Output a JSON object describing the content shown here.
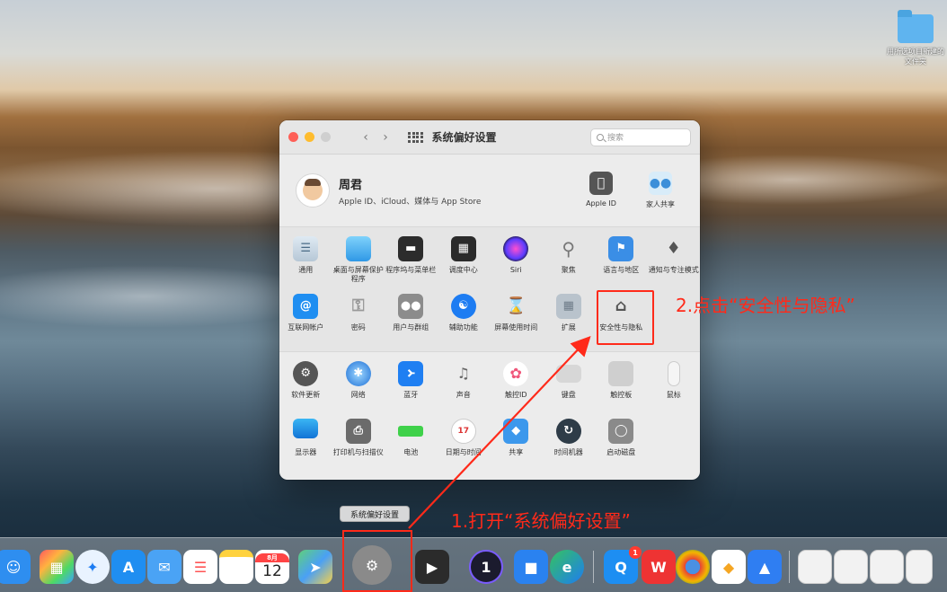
{
  "desktop": {
    "folder_label": "用所选项目新建的文件夹"
  },
  "window": {
    "title": "系统偏好设置",
    "search_placeholder": "搜索",
    "nav_back": "‹",
    "nav_forward": "›"
  },
  "account": {
    "name": "周君",
    "subtitle": "Apple ID、iCloud、媒体与 App Store",
    "apple_id_label": "Apple ID",
    "family_label": "家人共享"
  },
  "sections": {
    "row1": [
      {
        "label": "通用",
        "icon": "general-icon"
      },
      {
        "label": "桌面与屏幕保护程序",
        "icon": "desktop-icon"
      },
      {
        "label": "程序坞与菜单栏",
        "icon": "dock-icon"
      },
      {
        "label": "调度中心",
        "icon": "mission-control-icon"
      },
      {
        "label": "Siri",
        "icon": "siri-icon"
      },
      {
        "label": "聚焦",
        "icon": "spotlight-icon"
      },
      {
        "label": "语言与地区",
        "icon": "language-icon"
      },
      {
        "label": "通知与专注模式",
        "icon": "notifications-icon"
      }
    ],
    "row2": [
      {
        "label": "互联网帐户",
        "icon": "internet-accounts-icon"
      },
      {
        "label": "密码",
        "icon": "passwords-icon"
      },
      {
        "label": "用户与群组",
        "icon": "users-icon"
      },
      {
        "label": "辅助功能",
        "icon": "accessibility-icon"
      },
      {
        "label": "屏幕使用时间",
        "icon": "screen-time-icon"
      },
      {
        "label": "扩展",
        "icon": "extensions-icon"
      },
      {
        "label": "安全性与隐私",
        "icon": "security-icon"
      }
    ],
    "row3": [
      {
        "label": "软件更新",
        "icon": "software-update-icon"
      },
      {
        "label": "网络",
        "icon": "network-icon"
      },
      {
        "label": "蓝牙",
        "icon": "bluetooth-icon"
      },
      {
        "label": "声音",
        "icon": "sound-icon"
      },
      {
        "label": "触控ID",
        "icon": "touch-id-icon"
      },
      {
        "label": "键盘",
        "icon": "keyboard-icon"
      },
      {
        "label": "触控板",
        "icon": "trackpad-icon"
      },
      {
        "label": "鼠标",
        "icon": "mouse-icon"
      }
    ],
    "row4": [
      {
        "label": "显示器",
        "icon": "displays-icon"
      },
      {
        "label": "打印机与扫描仪",
        "icon": "printers-icon"
      },
      {
        "label": "电池",
        "icon": "battery-icon"
      },
      {
        "label": "日期与时间",
        "icon": "date-time-icon"
      },
      {
        "label": "共享",
        "icon": "sharing-icon"
      },
      {
        "label": "时间机器",
        "icon": "time-machine-icon"
      },
      {
        "label": "启动磁盘",
        "icon": "startup-disk-icon"
      }
    ]
  },
  "annotations": {
    "step1": "1.打开“系统偏好设置”",
    "step2": "2.点击“安全性与隐私”"
  },
  "dock": {
    "tooltip": "系统偏好设置",
    "calendar_month": "8月",
    "calendar_day": "12",
    "mail_badge": "1"
  },
  "colors": {
    "annotation_red": "#ff2a1a",
    "window_bg": "#ececec"
  }
}
